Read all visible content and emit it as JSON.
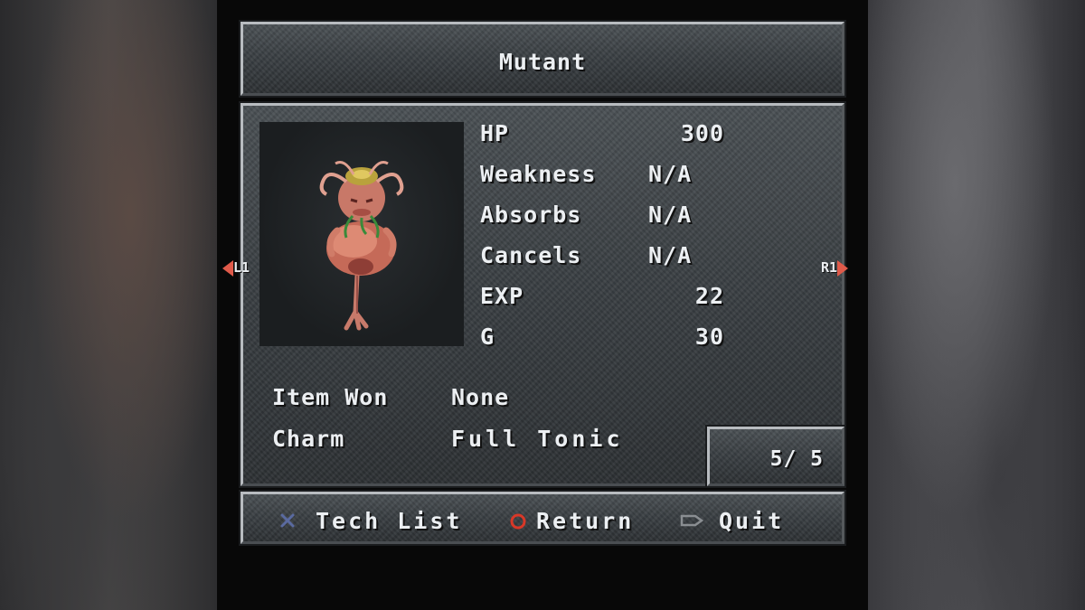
{
  "enemy": {
    "name": "Mutant",
    "stats": [
      {
        "label": "HP",
        "value": "300"
      },
      {
        "label": "Weakness",
        "value": "N/A"
      },
      {
        "label": "Absorbs",
        "value": "N/A"
      },
      {
        "label": "Cancels",
        "value": "N/A"
      },
      {
        "label": "EXP",
        "value": "22"
      },
      {
        "label": "G",
        "value": "30"
      }
    ],
    "item_won_label": "Item Won",
    "item_won_value": "None",
    "charm_label": "Charm",
    "charm_value": "Full Tonic"
  },
  "pager": {
    "count": "5/ 5",
    "prev_label": "L1",
    "next_label": "R1"
  },
  "controls": {
    "tech_list_label": "Tech List",
    "tech_list_icon": "cross-button-icon",
    "return_label": "Return",
    "return_icon": "circle-button-icon",
    "quit_label": "Quit",
    "quit_icon": "select-button-icon"
  },
  "colors": {
    "text": "#eceff2",
    "arrow": "#e05a4a",
    "circle": "#d83828",
    "cross": "#5a6aa0"
  }
}
